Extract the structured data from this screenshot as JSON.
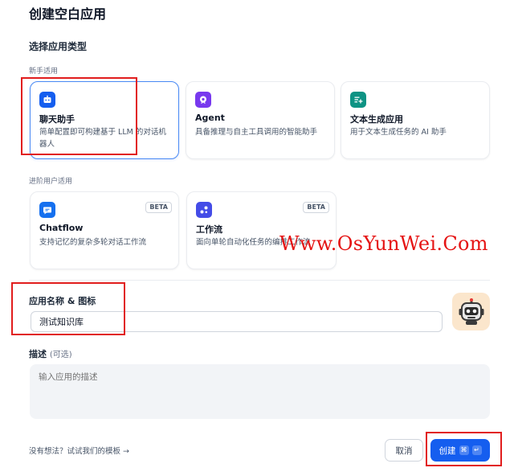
{
  "title": "创建空白应用",
  "section_title": "选择应用类型",
  "groups": {
    "beginner": "新手适用",
    "advanced": "进阶用户适用"
  },
  "cards": [
    {
      "name": "聊天助手",
      "desc": "简单配置即可构建基于 LLM 的对话机器人",
      "icon": "robot-chat-icon",
      "color": "#155eef"
    },
    {
      "name": "Agent",
      "desc": "具备推理与自主工具调用的智能助手",
      "icon": "agent-icon",
      "color": "#7839ee"
    },
    {
      "name": "文本生成应用",
      "desc": "用于文本生成任务的 AI 助手",
      "icon": "text-generation-icon",
      "color": "#0e9384"
    },
    {
      "name": "Chatflow",
      "desc": "支持记忆的复杂多轮对话工作流",
      "icon": "chatflow-icon",
      "color": "#1570ef",
      "badge": "BETA"
    },
    {
      "name": "工作流",
      "desc": "面向单轮自动化任务的编排工作流",
      "icon": "workflow-icon",
      "color": "#444ce7",
      "badge": "BETA"
    }
  ],
  "name_field": {
    "label": "应用名称 & 图标",
    "value": "测试知识库"
  },
  "description_field": {
    "label": "描述",
    "optional": "(可选)",
    "placeholder": "输入应用的描述"
  },
  "footer": {
    "template_link": "没有想法？试试我们的模板 →",
    "cancel": "取消",
    "create": "创建",
    "shortcut_cmd": "⌘",
    "shortcut_enter": "↵"
  },
  "watermark": "Www.OsYunWei.Com",
  "colors": {
    "primary": "#155eef",
    "highlight": "#e11d1d"
  }
}
